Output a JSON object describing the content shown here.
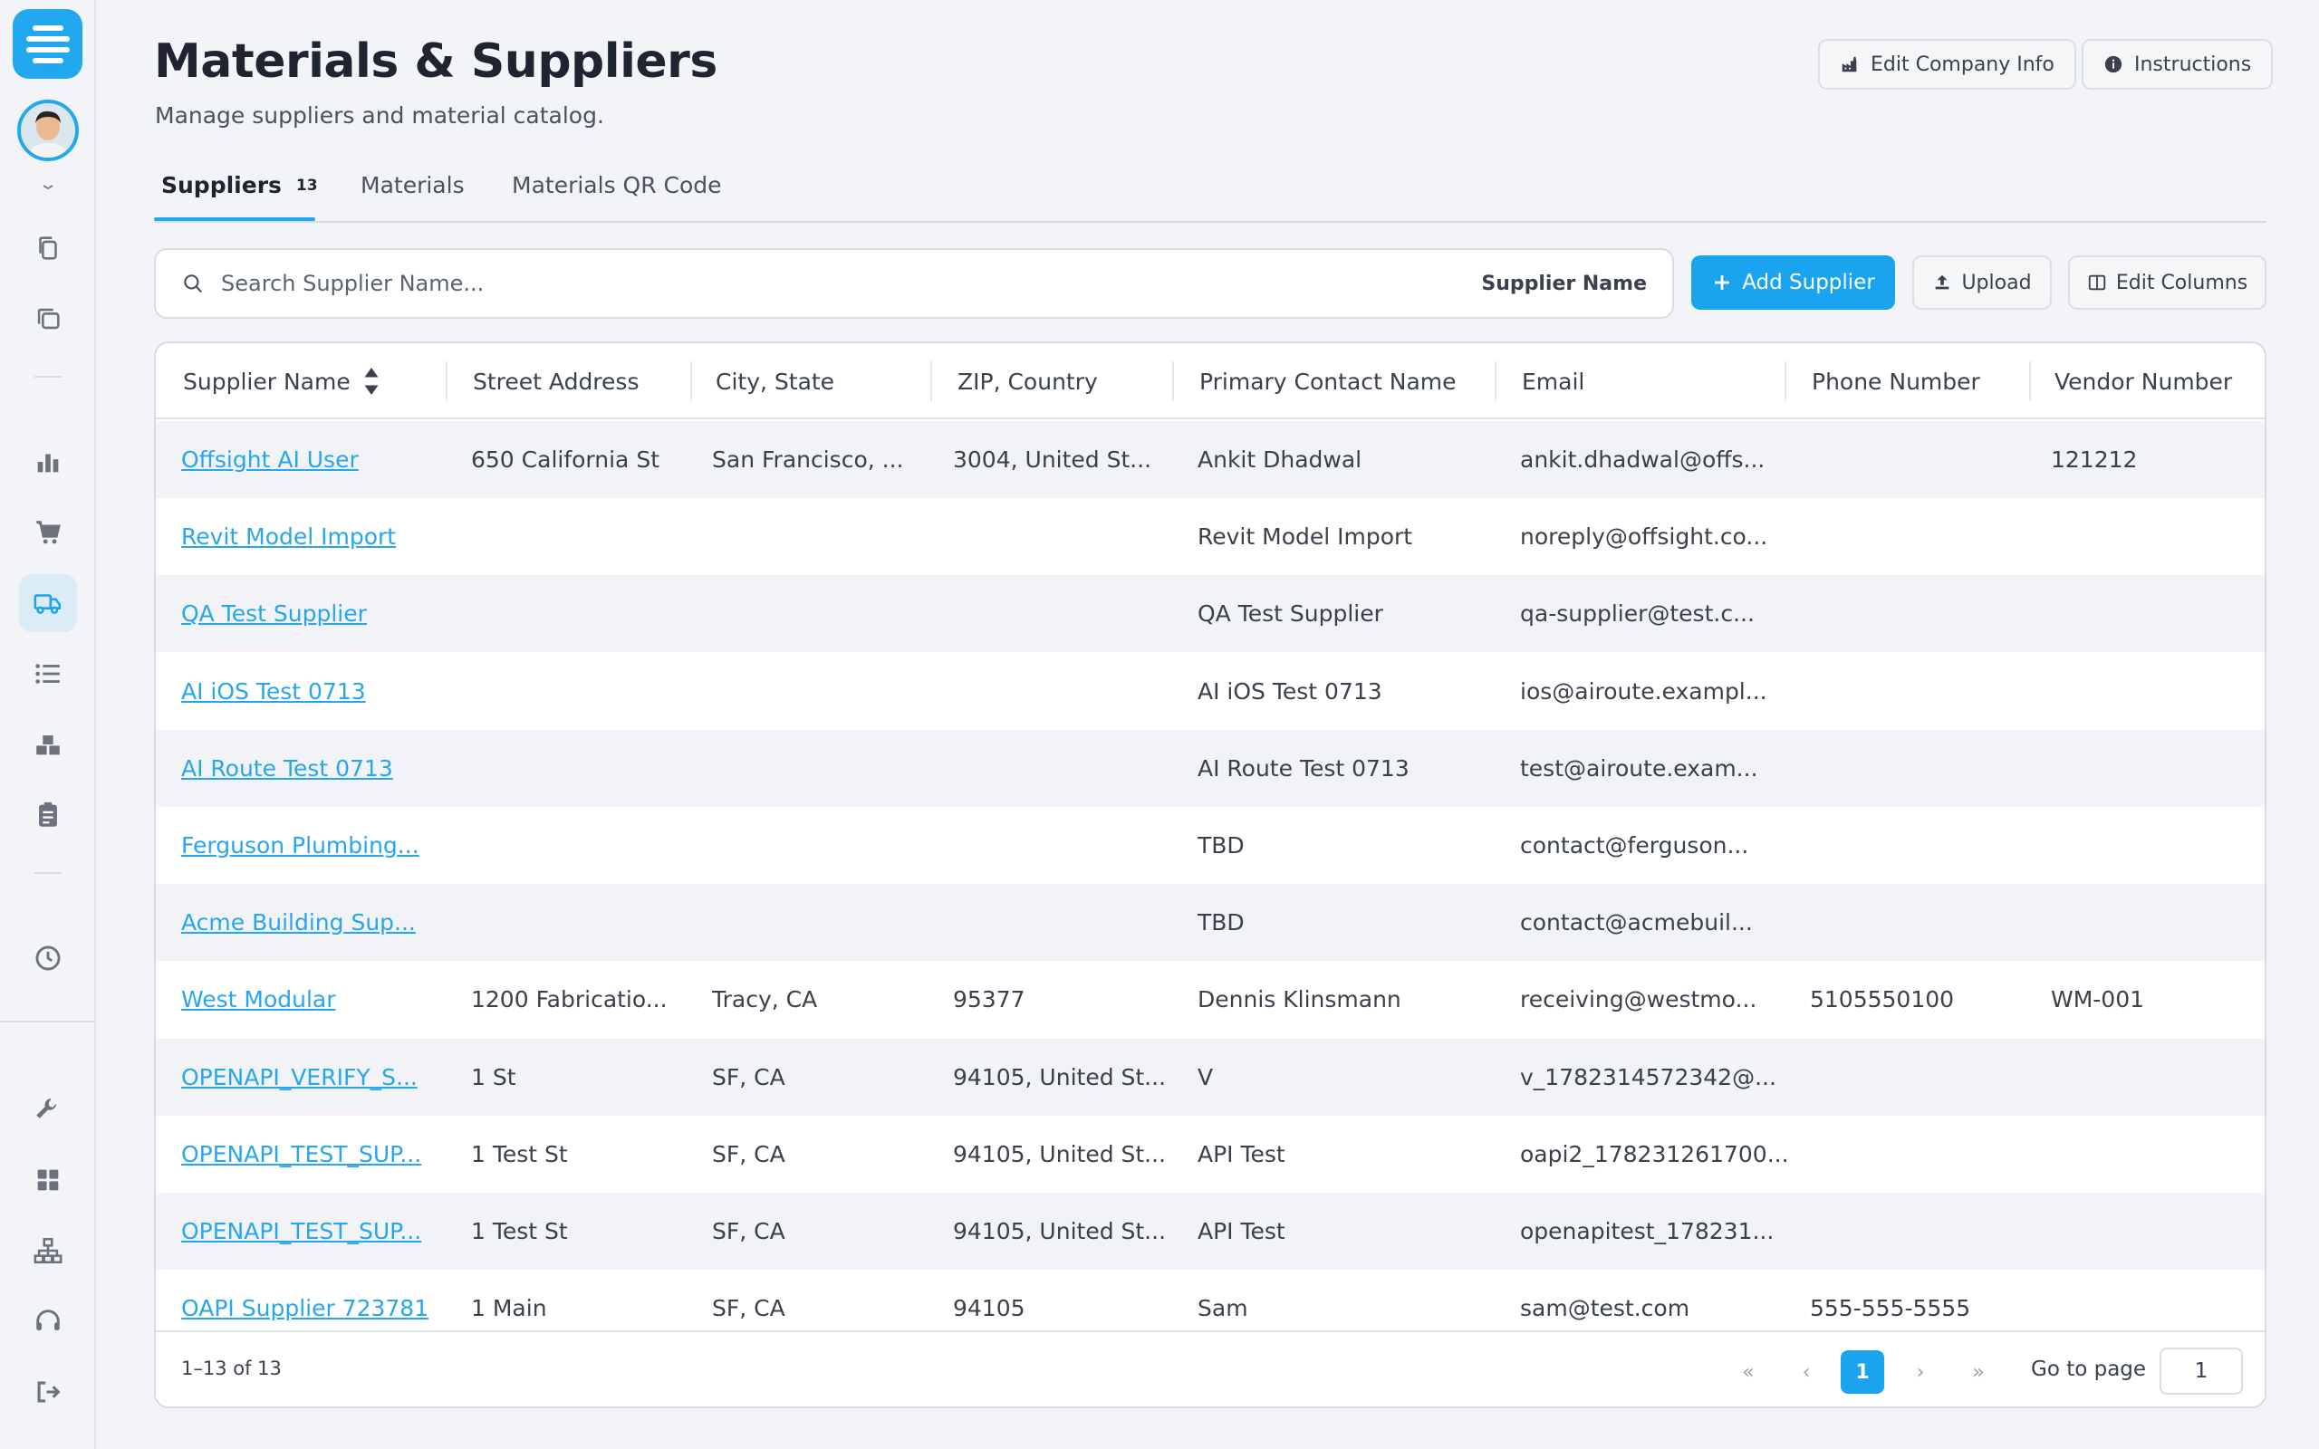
{
  "header": {
    "title": "Materials & Suppliers",
    "subtitle": "Manage suppliers and material catalog.",
    "edit_company_label": "Edit Company Info",
    "instructions_label": "Instructions"
  },
  "tabs": [
    {
      "label": "Suppliers",
      "count": "13"
    },
    {
      "label": "Materials"
    },
    {
      "label": "Materials QR Code"
    }
  ],
  "toolbar": {
    "search_placeholder": "Search Supplier Name...",
    "search_scope": "Supplier Name",
    "add_label": "Add Supplier",
    "upload_label": "Upload",
    "edit_columns_label": "Edit Columns"
  },
  "table": {
    "columns": [
      "Supplier Name",
      "Street Address",
      "City, State",
      "ZIP, Country",
      "Primary Contact Name",
      "Email",
      "Phone Number",
      "Vendor Number"
    ],
    "rows": [
      [
        "Offsight AI User",
        "650 California St",
        "San Francisco, ...",
        "3004, United St...",
        "Ankit Dhadwal",
        "ankit.dhadwal@offs...",
        "",
        "121212"
      ],
      [
        "Revit Model Import",
        "",
        "",
        "",
        "Revit Model Import",
        "noreply@offsight.co...",
        "",
        ""
      ],
      [
        "QA Test Supplier",
        "",
        "",
        "",
        "QA Test Supplier",
        "qa-supplier@test.c...",
        "",
        ""
      ],
      [
        "AI iOS Test 0713",
        "",
        "",
        "",
        "AI iOS Test 0713",
        "ios@airoute.exampl...",
        "",
        ""
      ],
      [
        "AI Route Test 0713",
        "",
        "",
        "",
        "AI Route Test 0713",
        "test@airoute.exam...",
        "",
        ""
      ],
      [
        "Ferguson Plumbing...",
        "",
        "",
        "",
        "TBD",
        "contact@ferguson...",
        "",
        ""
      ],
      [
        "Acme Building Sup...",
        "",
        "",
        "",
        "TBD",
        "contact@acmebuil...",
        "",
        ""
      ],
      [
        "West Modular",
        "1200 Fabricatio...",
        "Tracy, CA",
        "95377",
        "Dennis Klinsmann",
        "receiving@westmo...",
        "5105550100",
        "WM-001"
      ],
      [
        "OPENAPI_VERIFY_S...",
        "1 St",
        "SF, CA",
        "94105, United St...",
        "V",
        "v_1782314572342@...",
        "",
        ""
      ],
      [
        "OPENAPI_TEST_SUP...",
        "1 Test St",
        "SF, CA",
        "94105, United St...",
        "API Test",
        "oapi2_178231261700...",
        "",
        ""
      ],
      [
        "OPENAPI_TEST_SUP...",
        "1 Test St",
        "SF, CA",
        "94105, United St...",
        "API Test",
        "openapitest_178231...",
        "",
        ""
      ],
      [
        "OAPI Supplier 723781",
        "1 Main",
        "SF, CA",
        "94105",
        "Sam",
        "sam@test.com",
        "555-555-5555",
        ""
      ]
    ]
  },
  "pagination": {
    "range": "1–13 of 13",
    "first": "«",
    "prev": "‹",
    "current_page": "1",
    "next": "›",
    "last": "»",
    "goto_label": "Go to page",
    "goto_value": "1"
  },
  "colors": {
    "accent": "#1aa3ee",
    "link": "#27a6ee",
    "background": "#f3f4f7"
  },
  "sidebar_icons": [
    "chevrons-down-icon",
    "copy-icon",
    "copy-alt-icon",
    "bar-chart-icon",
    "cart-icon",
    "truck-icon",
    "list-icon",
    "boxes-icon",
    "clipboard-icon",
    "clock-icon",
    "wrench-icon",
    "grid-icon",
    "sitemap-icon",
    "headset-icon",
    "logout-icon"
  ]
}
